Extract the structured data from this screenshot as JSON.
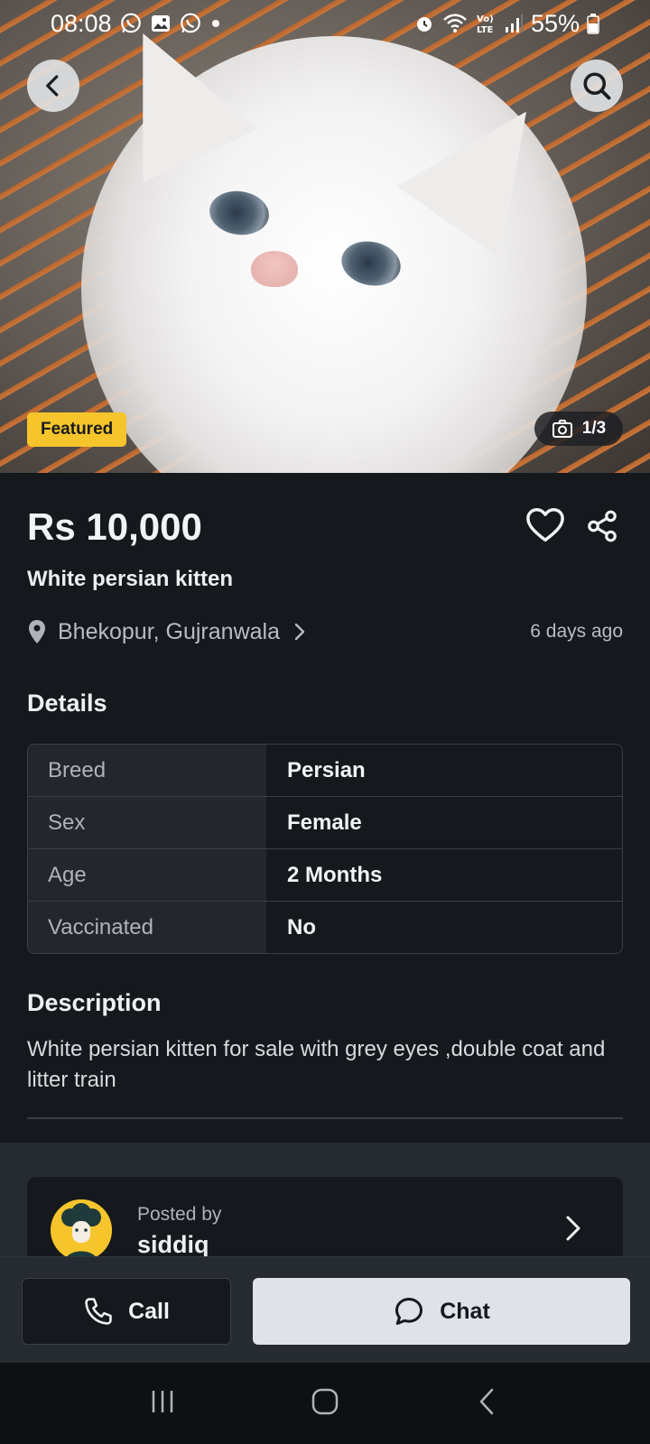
{
  "status_bar": {
    "time": "08:08",
    "battery": "55%",
    "icons": [
      "whatsapp-icon",
      "gallery-icon",
      "whatsapp-icon",
      "dot-icon",
      "alarm-icon",
      "wifi-icon",
      "volte-icon",
      "signal-icon",
      "battery-icon"
    ]
  },
  "hero": {
    "badge": "Featured",
    "image_counter": "1/3"
  },
  "listing": {
    "price": "Rs 10,000",
    "title": "White persian kitten",
    "location": "Bhekopur, Gujranwala",
    "posted_ago": "6 days ago"
  },
  "details": {
    "heading": "Details",
    "rows": [
      {
        "key": "Breed",
        "value": "Persian"
      },
      {
        "key": "Sex",
        "value": "Female"
      },
      {
        "key": "Age",
        "value": "2 Months"
      },
      {
        "key": "Vaccinated",
        "value": "No"
      }
    ]
  },
  "description": {
    "heading": "Description",
    "text": "White persian kitten for sale with grey eyes ,double coat and litter train"
  },
  "seller": {
    "posted_by_label": "Posted by",
    "name": "siddiq"
  },
  "actions": {
    "call_label": "Call",
    "chat_label": "Chat"
  },
  "colors": {
    "background": "#15181d",
    "badge": "#f5c52b",
    "chat_button": "#dfe2e7"
  }
}
